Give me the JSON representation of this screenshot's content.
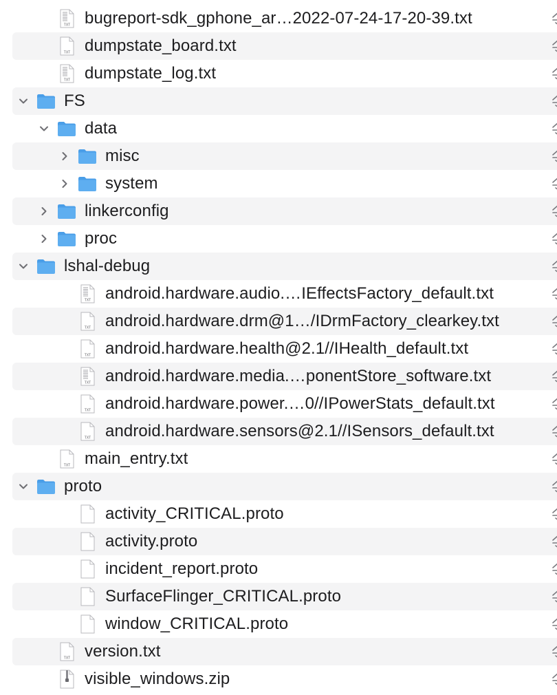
{
  "colors": {
    "stripe": "#f4f4f5",
    "folder_fill": "#5eaef0",
    "folder_tab": "#4a9ee8",
    "text": "#1d1d1f",
    "chevron": "#6e6e73",
    "cloud_icon": "#7a7a7f"
  },
  "rows": [
    {
      "label": "bugreport-sdk_gphone_ar…2022-07-24-17-20-39.txt",
      "kind": "txt-lines",
      "depth": 1,
      "disclosure": "none",
      "icon": "text-file-icon",
      "status_icon": "cloud-download-icon"
    },
    {
      "label": "dumpstate_board.txt",
      "kind": "txt",
      "depth": 1,
      "disclosure": "none",
      "icon": "text-file-icon",
      "status_icon": "cloud-download-icon"
    },
    {
      "label": "dumpstate_log.txt",
      "kind": "txt-lines",
      "depth": 1,
      "disclosure": "none",
      "icon": "text-file-icon",
      "status_icon": "cloud-download-icon"
    },
    {
      "label": "FS",
      "kind": "folder",
      "depth": 0,
      "disclosure": "expanded",
      "icon": "folder-icon",
      "status_icon": "cloud-download-icon"
    },
    {
      "label": "data",
      "kind": "folder",
      "depth": 1,
      "disclosure": "expanded",
      "icon": "folder-icon",
      "status_icon": "cloud-download-icon"
    },
    {
      "label": "misc",
      "kind": "folder",
      "depth": 2,
      "disclosure": "collapsed",
      "icon": "folder-icon",
      "status_icon": "cloud-download-icon"
    },
    {
      "label": "system",
      "kind": "folder",
      "depth": 2,
      "disclosure": "collapsed",
      "icon": "folder-icon",
      "status_icon": "cloud-download-icon"
    },
    {
      "label": "linkerconfig",
      "kind": "folder",
      "depth": 1,
      "disclosure": "collapsed",
      "icon": "folder-icon",
      "status_icon": "cloud-download-icon"
    },
    {
      "label": "proc",
      "kind": "folder",
      "depth": 1,
      "disclosure": "collapsed",
      "icon": "folder-icon",
      "status_icon": "cloud-download-icon"
    },
    {
      "label": "lshal-debug",
      "kind": "folder",
      "depth": 0,
      "disclosure": "expanded",
      "icon": "folder-icon",
      "status_icon": "cloud-download-icon"
    },
    {
      "label": "android.hardware.audio.…IEffectsFactory_default.txt",
      "kind": "txt-lines",
      "depth": 2,
      "disclosure": "none",
      "icon": "text-file-icon",
      "status_icon": "cloud-download-icon"
    },
    {
      "label": "android.hardware.drm@1…/IDrmFactory_clearkey.txt",
      "kind": "txt",
      "depth": 2,
      "disclosure": "none",
      "icon": "text-file-icon",
      "status_icon": "cloud-download-icon"
    },
    {
      "label": "android.hardware.health@2.1//IHealth_default.txt",
      "kind": "txt",
      "depth": 2,
      "disclosure": "none",
      "icon": "text-file-icon",
      "status_icon": "cloud-download-icon"
    },
    {
      "label": "android.hardware.media.…ponentStore_software.txt",
      "kind": "txt-lines",
      "depth": 2,
      "disclosure": "none",
      "icon": "text-file-icon",
      "status_icon": "cloud-download-icon"
    },
    {
      "label": "android.hardware.power.…0//IPowerStats_default.txt",
      "kind": "txt",
      "depth": 2,
      "disclosure": "none",
      "icon": "text-file-icon",
      "status_icon": "cloud-download-icon"
    },
    {
      "label": "android.hardware.sensors@2.1//ISensors_default.txt",
      "kind": "txt",
      "depth": 2,
      "disclosure": "none",
      "icon": "text-file-icon",
      "status_icon": "cloud-download-icon"
    },
    {
      "label": "main_entry.txt",
      "kind": "txt",
      "depth": 1,
      "disclosure": "none",
      "icon": "text-file-icon",
      "status_icon": "cloud-download-icon"
    },
    {
      "label": "proto",
      "kind": "folder",
      "depth": 0,
      "disclosure": "expanded",
      "icon": "folder-icon",
      "status_icon": "cloud-download-icon"
    },
    {
      "label": "activity_CRITICAL.proto",
      "kind": "blank",
      "depth": 2,
      "disclosure": "none",
      "icon": "document-icon",
      "status_icon": "cloud-download-icon"
    },
    {
      "label": "activity.proto",
      "kind": "blank",
      "depth": 2,
      "disclosure": "none",
      "icon": "document-icon",
      "status_icon": "cloud-download-icon"
    },
    {
      "label": "incident_report.proto",
      "kind": "blank",
      "depth": 2,
      "disclosure": "none",
      "icon": "document-icon",
      "status_icon": "cloud-download-icon"
    },
    {
      "label": "SurfaceFlinger_CRITICAL.proto",
      "kind": "blank",
      "depth": 2,
      "disclosure": "none",
      "icon": "document-icon",
      "status_icon": "cloud-download-icon"
    },
    {
      "label": "window_CRITICAL.proto",
      "kind": "blank",
      "depth": 2,
      "disclosure": "none",
      "icon": "document-icon",
      "status_icon": "cloud-download-icon"
    },
    {
      "label": "version.txt",
      "kind": "txt",
      "depth": 1,
      "disclosure": "none",
      "icon": "text-file-icon",
      "status_icon": "cloud-download-icon"
    },
    {
      "label": "visible_windows.zip",
      "kind": "zip",
      "depth": 1,
      "disclosure": "none",
      "icon": "zip-archive-icon",
      "status_icon": "cloud-download-icon"
    }
  ]
}
